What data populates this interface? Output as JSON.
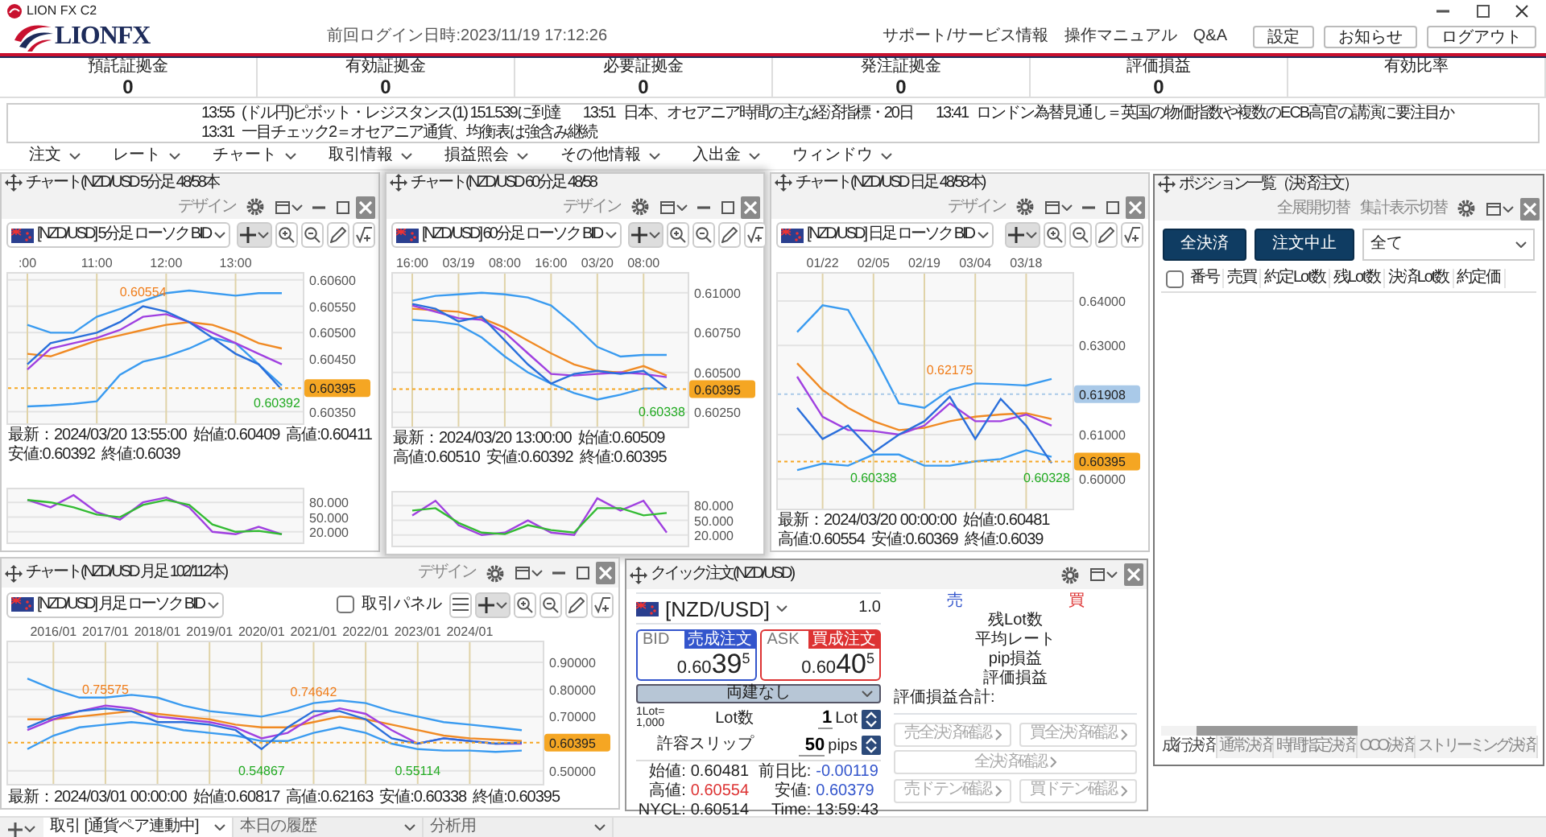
{
  "window": {
    "title": "LION FX C2"
  },
  "header": {
    "logo": "LIONFX",
    "last_login": "前回ログイン日時:2023/11/19 17:12:26",
    "links": [
      "サポート/サービス情報",
      "操作マニュアル",
      "Q&A"
    ],
    "buttons": [
      "設定",
      "お知らせ",
      "ログアウト"
    ]
  },
  "summary": [
    {
      "label": "預託証拠金",
      "value": "0"
    },
    {
      "label": "有効証拠金",
      "value": "0"
    },
    {
      "label": "必要証拠金",
      "value": "0"
    },
    {
      "label": "発注証拠金",
      "value": "0"
    },
    {
      "label": "評価損益",
      "value": "0"
    },
    {
      "label": "有効比率"
    }
  ],
  "ticker": [
    {
      "time": "13:55",
      "text": "(ドル円)ピボット・レジスタンス(1) 151.539に到達"
    },
    {
      "time": "13:51",
      "text": "日本、オセアニア時間の主な経済指標・20日"
    },
    {
      "time": "13:41",
      "text": "ロンドン為替見通し＝英国の物価指数や複数のECB高官の講演に要注目か"
    },
    {
      "time": "13:31",
      "text": "一目チェック2＝オセアニア通貨、均衡表は強含み継続"
    }
  ],
  "menu": [
    "注文",
    "レート",
    "チャート",
    "取引情報",
    "損益照会",
    "その他情報",
    "入出金",
    "ウィンドウ"
  ],
  "charts": [
    {
      "title": "チャート(NZD/USD 5分足 48/58本",
      "design": "デザイン",
      "active": false,
      "symbol": "[NZD/USD] 5分足 ローソク BID",
      "chart_data": {
        "type": "line",
        "grid": true,
        "categories": [
          ":00",
          null,
          null,
          "11:00",
          null,
          null,
          "12:00",
          null,
          null,
          "13:00",
          null,
          null
        ],
        "ylim": [
          0.60325,
          0.60615
        ],
        "yticks": [
          {
            "value": 0.606,
            "label": "0.60600"
          },
          {
            "value": 0.6055,
            "label": "0.60550"
          },
          {
            "value": 0.605,
            "label": "0.60500"
          },
          {
            "value": 0.6045,
            "label": "0.60450"
          },
          {
            "value": 0.6035,
            "label": "0.60350"
          }
        ],
        "series": [
          {
            "color": "#3a9bf0",
            "values": [
              0.60515,
              0.605,
              0.605,
              0.6053,
              0.60545,
              0.6056,
              0.60575,
              0.6058,
              0.60575,
              0.6057,
              0.60575,
              0.60575
            ]
          },
          {
            "color": "#3a9bf0",
            "values": [
              0.6036,
              0.60362,
              0.60365,
              0.6037,
              0.6042,
              0.60445,
              0.60455,
              0.6047,
              0.6049,
              0.6048,
              0.6044,
              0.604
            ]
          },
          {
            "color": "#f08a24",
            "values": [
              0.6046,
              0.60455,
              0.6047,
              0.60485,
              0.60495,
              0.60505,
              0.60515,
              0.6052,
              0.60515,
              0.605,
              0.6048,
              0.6047
            ]
          },
          {
            "color": "#a040e0",
            "values": [
              0.6043,
              0.6047,
              0.6048,
              0.6049,
              0.60505,
              0.6053,
              0.60535,
              0.6052,
              0.605,
              0.6048,
              0.6046,
              0.6044
            ]
          },
          {
            "color": "#2a6fdb",
            "values": [
              0.6044,
              0.6048,
              0.6049,
              0.605,
              0.6052,
              0.6055,
              0.6054,
              0.6052,
              0.6049,
              0.6046,
              0.6044,
              0.60392
            ]
          }
        ],
        "annotations": [
          "0.60554",
          "0.60392"
        ],
        "ref_lines": [
          {
            "axis": "y",
            "value": 0.60395,
            "label": "0.60395",
            "color": "#f5a623"
          }
        ]
      },
      "info": [
        "最新：2024/03/20 13:55:00",
        "始値:0.60409",
        "高値:0.60411",
        "安値:0.60392",
        "終値:0.6039"
      ],
      "oscillator": {
        "chart_data": {
          "type": "line",
          "grid": true,
          "categories": [
            null,
            null,
            null,
            null,
            null,
            null,
            null,
            null,
            null,
            null,
            null,
            null
          ],
          "ylim": [
            -5,
            110
          ],
          "yticks": [
            {
              "value": 80,
              "label": "80.000"
            },
            {
              "value": 50,
              "label": "50.000"
            },
            {
              "value": 20,
              "label": "20.000"
            }
          ],
          "series": [
            {
              "color": "#a040e0",
              "values": [
                85,
                70,
                95,
                60,
                45,
                80,
                90,
                70,
                20,
                15,
                30,
                15
              ]
            },
            {
              "color": "#33bb33",
              "values": [
                85,
                80,
                70,
                55,
                50,
                75,
                85,
                75,
                35,
                20,
                22,
                15
              ]
            }
          ]
        }
      }
    },
    {
      "title": "チャート(NZD/USD 60分足 48/58",
      "design": "デザイン",
      "active": true,
      "symbol": "[NZD/USD] 60分足 ローソク BID",
      "chart_data": {
        "type": "line",
        "grid": true,
        "categories": [
          "16:00",
          null,
          "03/19",
          null,
          "08:00",
          null,
          "16:00",
          null,
          "03/20",
          null,
          "08:00",
          null
        ],
        "ylim": [
          0.6015,
          0.6113
        ],
        "yticks": [
          {
            "value": 0.61,
            "label": "0.61000"
          },
          {
            "value": 0.6075,
            "label": "0.60750"
          },
          {
            "value": 0.605,
            "label": "0.60500"
          },
          {
            "value": 0.6025,
            "label": "0.60250"
          }
        ],
        "series": [
          {
            "color": "#3a9bf0",
            "values": [
              0.6095,
              0.6098,
              0.6099,
              0.61,
              0.6099,
              0.6097,
              0.6092,
              0.608,
              0.6066,
              0.606,
              0.6061,
              0.6061
            ]
          },
          {
            "color": "#3a9bf0",
            "values": [
              0.6083,
              0.6082,
              0.608,
              0.6072,
              0.606,
              0.605,
              0.6043,
              0.6037,
              0.6033,
              0.6036,
              0.604,
              0.604
            ]
          },
          {
            "color": "#f08a24",
            "values": [
              0.609,
              0.6089,
              0.6088,
              0.6084,
              0.6078,
              0.607,
              0.6062,
              0.6055,
              0.6051,
              0.605,
              0.6054,
              0.6048
            ]
          },
          {
            "color": "#a040e0",
            "values": [
              0.6092,
              0.6088,
              0.6084,
              0.6083,
              0.6075,
              0.6062,
              0.6049,
              0.6048,
              0.6049,
              0.605,
              0.6049,
              0.6047
            ]
          },
          {
            "color": "#2a6fdb",
            "values": [
              0.6093,
              0.609,
              0.6082,
              0.6085,
              0.607,
              0.6055,
              0.6043,
              0.6049,
              0.6051,
              0.6049,
              0.6051,
              0.604
            ]
          }
        ],
        "annotations": [
          "0.60338"
        ],
        "ref_lines": [
          {
            "axis": "y",
            "value": 0.60395,
            "label": "0.60395",
            "color": "#f5a623"
          }
        ]
      },
      "info": [
        "最新：2024/03/20 13:00:00",
        "始値:0.60509",
        "高値:0.60510",
        "安値:0.60392",
        "終値:0.60395"
      ],
      "oscillator": {
        "chart_data": {
          "type": "line",
          "grid": true,
          "categories": [
            null,
            null,
            null,
            null,
            null,
            null,
            null,
            null,
            null,
            null,
            null,
            null
          ],
          "ylim": [
            -5,
            110
          ],
          "yticks": [
            {
              "value": 80,
              "label": "80.000"
            },
            {
              "value": 50,
              "label": "50.000"
            },
            {
              "value": 20,
              "label": "20.000"
            }
          ],
          "series": [
            {
              "color": "#a040e0",
              "values": [
                60,
                90,
                40,
                20,
                25,
                50,
                25,
                20,
                95,
                70,
                90,
                25
              ]
            },
            {
              "color": "#33bb33",
              "values": [
                70,
                75,
                45,
                25,
                22,
                40,
                30,
                25,
                75,
                75,
                60,
                65
              ]
            }
          ]
        }
      }
    },
    {
      "title": "チャート(NZD/USD 日足 48/58本)",
      "design": "デザイン",
      "active": false,
      "symbol": "[NZD/USD] 日足 ローソク BID",
      "chart_data": {
        "type": "line",
        "grid": true,
        "categories": [
          null,
          "01/22",
          null,
          "02/05",
          null,
          "02/19",
          null,
          "03/04",
          null,
          "03/18",
          null
        ],
        "ylim": [
          0.593,
          0.6465
        ],
        "yticks": [
          {
            "value": 0.64,
            "label": "0.64000"
          },
          {
            "value": 0.63,
            "label": "0.63000"
          },
          {
            "value": 0.61,
            "label": "0.61000"
          },
          {
            "value": 0.6,
            "label": "0.60000"
          }
        ],
        "series": [
          {
            "color": "#3a9bf0",
            "values": [
              0.633,
              0.639,
              0.638,
              0.628,
              0.617,
              0.616,
              0.62,
              0.6215,
              0.6213,
              0.621,
              0.6225
            ]
          },
          {
            "color": "#3a9bf0",
            "values": [
              0.602,
              0.6035,
              0.603,
              0.6055,
              0.6055,
              0.603,
              0.603,
              0.604,
              0.6045,
              0.6065,
              0.605
            ]
          },
          {
            "color": "#f08a24",
            "values": [
              0.626,
              0.62,
              0.616,
              0.613,
              0.611,
              0.6115,
              0.613,
              0.614,
              0.6145,
              0.6148,
              0.6135
            ]
          },
          {
            "color": "#a040e0",
            "values": [
              0.623,
              0.614,
              0.611,
              0.6108,
              0.61,
              0.612,
              0.617,
              0.613,
              0.613,
              0.6145,
              0.612
            ]
          },
          {
            "color": "#2a6fdb",
            "values": [
              0.616,
              0.609,
              0.612,
              0.606,
              0.61,
              0.613,
              0.6185,
              0.609,
              0.618,
              0.612,
              0.6036
            ]
          }
        ],
        "annotations": [
          "0.62175",
          "0.60328",
          "0.60338"
        ],
        "ref_lines": [
          {
            "axis": "y",
            "value": 0.61908,
            "label": "0.61908",
            "color": "#a9c9e8"
          },
          {
            "axis": "y",
            "value": 0.60395,
            "label": "0.60395",
            "color": "#f5a623"
          }
        ]
      },
      "info": [
        "最新：2024/03/20 00:00:00",
        "始値:0.60481",
        "高値:0.60554",
        "安値:0.60369",
        "終値:0.6039"
      ]
    },
    {
      "title": "チャート(NZD/USD 月足 102/112本)",
      "design": "デザイン",
      "active": false,
      "symbol": "[NZD/USD] 月足 ローソク BID",
      "trade_panel": {
        "label": "取引パネル",
        "checked": false
      },
      "chart_data": {
        "type": "line",
        "grid": true,
        "categories": [
          null,
          "2016/01",
          null,
          "2017/01",
          null,
          "2018/01",
          null,
          "2019/01",
          null,
          "2020/01",
          null,
          "2021/01",
          null,
          "2022/01",
          null,
          "2023/01",
          null,
          "2024/01",
          null,
          null
        ],
        "ylim": [
          0.446,
          0.98
        ],
        "yticks": [
          {
            "value": 0.9,
            "label": "0.90000"
          },
          {
            "value": 0.8,
            "label": "0.80000"
          },
          {
            "value": 0.7,
            "label": "0.70000"
          },
          {
            "value": 0.5,
            "label": "0.50000"
          }
        ],
        "series": [
          {
            "color": "#3a9bf0",
            "values": [
              0.84,
              0.8,
              0.77,
              0.77,
              0.78,
              0.77,
              0.74,
              0.72,
              0.71,
              0.7,
              0.72,
              0.75,
              0.76,
              0.75,
              0.72,
              0.7,
              0.68,
              0.67,
              0.66,
              0.65
            ]
          },
          {
            "color": "#3a9bf0",
            "values": [
              0.58,
              0.63,
              0.66,
              0.67,
              0.68,
              0.67,
              0.65,
              0.64,
              0.63,
              0.61,
              0.61,
              0.64,
              0.66,
              0.64,
              0.6,
              0.58,
              0.575,
              0.575,
              0.57,
              0.575
            ]
          },
          {
            "color": "#f08a24",
            "values": [
              0.69,
              0.69,
              0.7,
              0.71,
              0.72,
              0.71,
              0.7,
              0.69,
              0.67,
              0.66,
              0.66,
              0.68,
              0.7,
              0.69,
              0.67,
              0.65,
              0.63,
              0.62,
              0.615,
              0.61
            ]
          },
          {
            "color": "#a040e0",
            "values": [
              0.65,
              0.69,
              0.72,
              0.74,
              0.73,
              0.7,
              0.69,
              0.68,
              0.66,
              0.62,
              0.64,
              0.7,
              0.73,
              0.71,
              0.65,
              0.6,
              0.62,
              0.61,
              0.6,
              0.6
            ]
          },
          {
            "color": "#2a6fdb",
            "values": [
              0.66,
              0.7,
              0.72,
              0.73,
              0.72,
              0.68,
              0.68,
              0.67,
              0.65,
              0.58,
              0.66,
              0.72,
              0.72,
              0.69,
              0.62,
              0.6,
              0.62,
              0.61,
              0.6,
              0.604
            ]
          }
        ],
        "annotations": [
          "0.75575",
          "0.74642",
          "0.54867",
          "0.55114"
        ],
        "ref_lines": [
          {
            "axis": "y",
            "value": 0.60395,
            "label": "0.60395",
            "color": "#f5a623"
          }
        ]
      },
      "info": [
        "最新：2024/03/01 00:00:00",
        "始値:0.60817",
        "高値:0.62163",
        "安値:0.60338",
        "終値:0.60395"
      ]
    }
  ],
  "quick_order": {
    "title": "クイック注文(NZD/USD)",
    "pair": "[NZD/USD]",
    "lot_step": "1.0",
    "bid": {
      "label": "BID",
      "order_button": "売成注文",
      "price_head": "0.60",
      "price_big": "39",
      "price_pip": "5"
    },
    "ask": {
      "label": "ASK",
      "order_button": "買成注文",
      "price_head": "0.60",
      "price_big": "40",
      "price_pip": "5"
    },
    "hedge": "両建なし",
    "lot_note": [
      "1Lot=",
      "1,000"
    ],
    "lot": {
      "label": "Lot数",
      "value": "1",
      "unit": "Lot"
    },
    "slip": {
      "label": "許容スリップ",
      "value": "50",
      "unit": "pips"
    },
    "stats": [
      {
        "label": "始値:",
        "value": "0.60481",
        "color": "#222222"
      },
      {
        "label": "前日比:",
        "value": "-0.00119",
        "color": "#3355cc"
      },
      {
        "label": "高値:",
        "value": "0.60554",
        "color": "#dd3333"
      },
      {
        "label": "安値:",
        "value": "0.60379",
        "color": "#3355cc"
      },
      {
        "label": "NYCL:",
        "value": "0.60514",
        "color": "#222222"
      },
      {
        "label": "Time:",
        "value": "13:59:43",
        "color": "#222222"
      }
    ],
    "sell_label": "売",
    "buy_label": "買",
    "position_labels": [
      "残Lot数",
      "平均レート",
      "pip損益",
      "評価損益"
    ],
    "total_label": "評価損益合計:",
    "action_rows": [
      [
        {
          "label": "売全決済確認",
          "disabled": true
        },
        {
          "label": "買全決済確認",
          "disabled": true
        }
      ],
      [
        {
          "label": "全決済確認",
          "disabled": true
        }
      ],
      [
        {
          "label": "売ドテン確認",
          "disabled": true
        },
        {
          "label": "買ドテン確認",
          "disabled": true
        }
      ]
    ]
  },
  "positions": {
    "title": "ポジション一覧（決済注文）",
    "links": [
      "全展開切替",
      "集計表示切替"
    ],
    "buttons": [
      "全決済",
      "注文中止"
    ],
    "filter": "全て",
    "select_all": {
      "checked": false
    },
    "columns": [
      "番号",
      "売買",
      "約定Lot数",
      "残Lot数",
      "決済Lot数",
      "約定価"
    ],
    "tabs": [
      {
        "label": "成行決済",
        "selected": true
      },
      {
        "label": "通常決済",
        "selected": false
      },
      {
        "label": "時間指定決済",
        "selected": false
      },
      {
        "label": "OCO決済",
        "selected": false
      },
      {
        "label": "ストリーミング決済",
        "selected": false
      }
    ]
  },
  "bottom_tabs": [
    {
      "label": "取引 [通貨ペア連動中]",
      "selected": true
    },
    {
      "label": "本日の履歴",
      "selected": false
    },
    {
      "label": "分析用",
      "selected": false
    }
  ]
}
